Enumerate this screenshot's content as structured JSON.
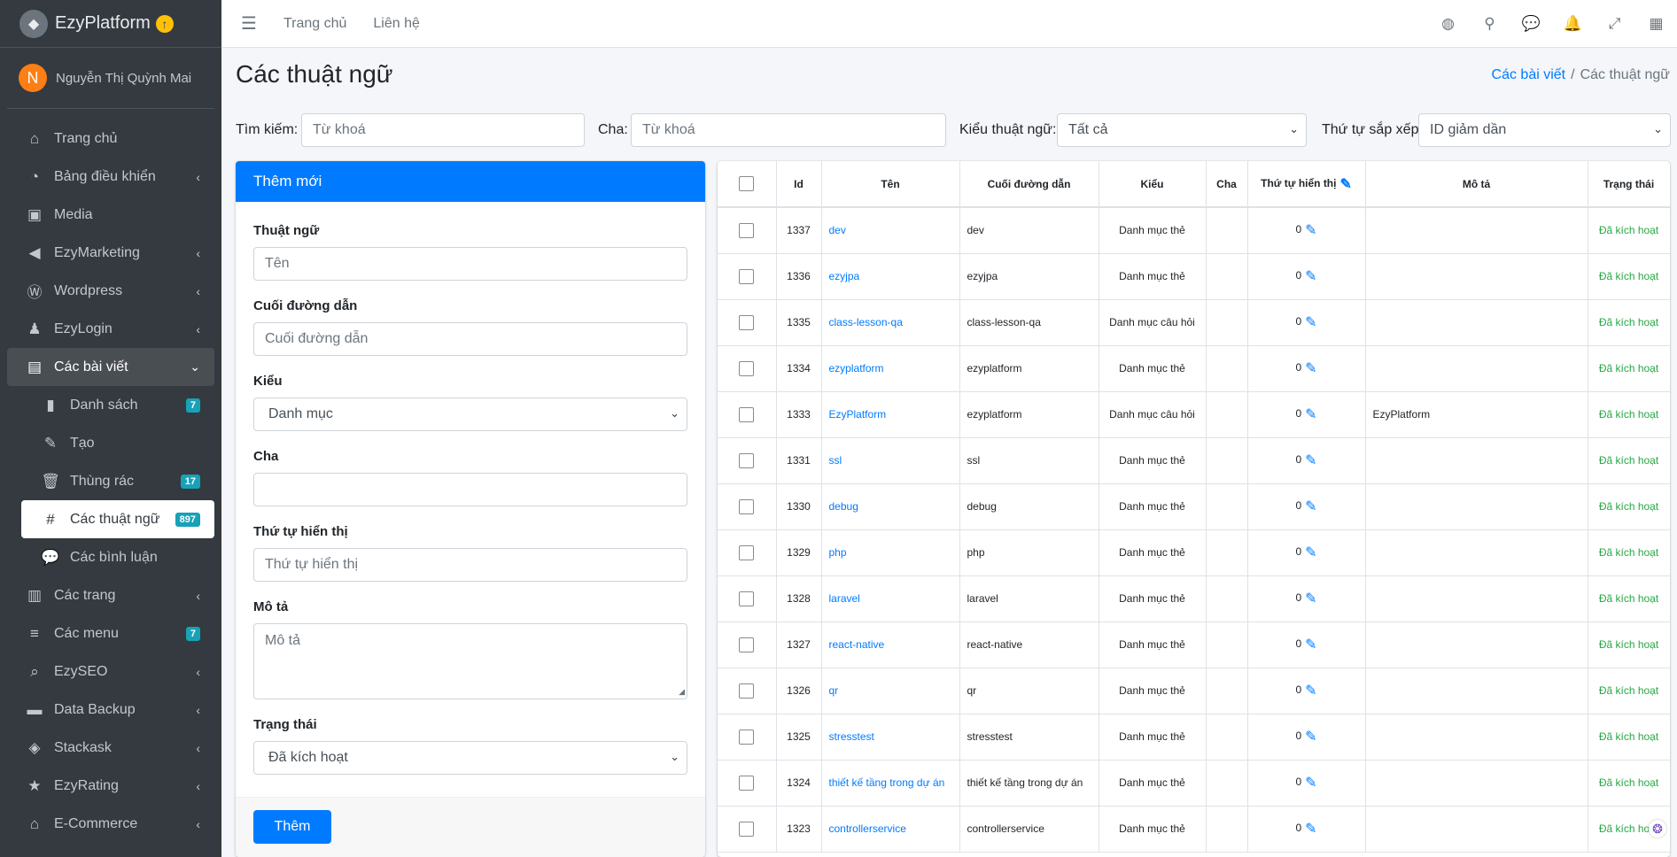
{
  "brand": {
    "name": "EzyPlatform",
    "logo_icon": "cube-icon",
    "upgrade_icon": "arrow-up-circle-icon"
  },
  "user": {
    "initial": "N",
    "name": "Nguyễn Thị Quỳnh Mai"
  },
  "sidebar": {
    "items": [
      {
        "label": "Trang chủ",
        "icon": "home-icon",
        "glyph": "⌂"
      },
      {
        "label": "Bảng điều khiển",
        "icon": "dashboard-icon",
        "glyph": "◔",
        "arrow": "‹"
      },
      {
        "label": "Media",
        "icon": "image-icon",
        "glyph": "▣"
      },
      {
        "label": "EzyMarketing",
        "icon": "bullhorn-icon",
        "glyph": "◀",
        "arrow": "‹"
      },
      {
        "label": "Wordpress",
        "icon": "wordpress-icon",
        "glyph": "Ⓦ",
        "arrow": "‹"
      },
      {
        "label": "EzyLogin",
        "icon": "user-lock-icon",
        "glyph": "♟",
        "arrow": "‹"
      },
      {
        "label": "Các bài viết",
        "icon": "newspaper-icon",
        "glyph": "▤",
        "arrow": "⌄"
      },
      {
        "label": "Danh sách",
        "icon": "book-icon",
        "glyph": "▮",
        "badge": "7"
      },
      {
        "label": "Tạo",
        "icon": "edit-icon",
        "glyph": "✎"
      },
      {
        "label": "Thùng rác",
        "icon": "trash-icon",
        "glyph": "🗑",
        "badge": "17"
      },
      {
        "label": "Các thuật ngữ",
        "icon": "hashtag-icon",
        "glyph": "#",
        "badge": "897"
      },
      {
        "label": "Các bình luận",
        "icon": "comments-icon",
        "glyph": "💬"
      },
      {
        "label": "Các trang",
        "icon": "columns-icon",
        "glyph": "▥",
        "arrow": "‹"
      },
      {
        "label": "Các menu",
        "icon": "bars-icon",
        "glyph": "≡",
        "badge": "7"
      },
      {
        "label": "EzySEO",
        "icon": "search-plus-icon",
        "glyph": "⌕",
        "arrow": "‹"
      },
      {
        "label": "Data Backup",
        "icon": "folder-icon",
        "glyph": "▬",
        "arrow": "‹"
      },
      {
        "label": "Stackask",
        "icon": "layer-group-icon",
        "glyph": "◈",
        "arrow": "‹"
      },
      {
        "label": "EzyRating",
        "icon": "star-icon",
        "glyph": "★",
        "arrow": "‹"
      },
      {
        "label": "E-Commerce",
        "icon": "store-icon",
        "glyph": "⌂",
        "arrow": "‹"
      }
    ]
  },
  "topnav": {
    "links": [
      "Trang chủ",
      "Liên hệ"
    ],
    "icons": [
      {
        "name": "globe-icon",
        "glyph": "◍"
      },
      {
        "name": "search-icon",
        "glyph": "⚲"
      },
      {
        "name": "comments-icon",
        "glyph": "💬"
      },
      {
        "name": "bell-icon",
        "glyph": "🔔"
      },
      {
        "name": "expand-icon",
        "glyph": "⤢"
      },
      {
        "name": "grid-icon",
        "glyph": "▦"
      }
    ]
  },
  "page": {
    "title": "Các thuật ngữ",
    "breadcrumb": {
      "parent": "Các bài viết",
      "current": "Các thuật ngữ"
    }
  },
  "filters": {
    "search_label": "Tìm kiếm:",
    "search_placeholder": "Từ khoá",
    "parent_label": "Cha:",
    "parent_placeholder": "Từ khoá",
    "type_label": "Kiểu thuật ngữ:",
    "type_value": "Tất cả",
    "sort_label": "Thứ tự sắp xếp:",
    "sort_value": "ID giảm dần"
  },
  "form": {
    "header": "Thêm mới",
    "term_label": "Thuật ngữ",
    "term_placeholder": "Tên",
    "slug_label": "Cuối đường dẫn",
    "slug_placeholder": "Cuối đường dẫn",
    "type_label": "Kiểu",
    "type_value": "Danh mục",
    "parent_label": "Cha",
    "parent_value": "",
    "order_label": "Thứ tự hiển thị",
    "order_placeholder": "Thứ tự hiển thị",
    "desc_label": "Mô tả",
    "desc_placeholder": "Mô tả",
    "status_label": "Trạng thái",
    "status_value": "Đã kích hoạt",
    "submit": "Thêm"
  },
  "table": {
    "headers": {
      "id": "Id",
      "name": "Tên",
      "slug": "Cuối đường dẫn",
      "type": "Kiểu",
      "parent": "Cha",
      "order": "Thứ tự hiển thị",
      "desc": "Mô tả",
      "status": "Trạng thái"
    },
    "rows": [
      {
        "id": "1337",
        "name": "dev",
        "slug": "dev",
        "type": "Danh mục thẻ",
        "parent": "",
        "order": "0",
        "desc": "",
        "status": "Đã kích hoạt"
      },
      {
        "id": "1336",
        "name": "ezyjpa",
        "slug": "ezyjpa",
        "type": "Danh mục thẻ",
        "parent": "",
        "order": "0",
        "desc": "",
        "status": "Đã kích hoạt"
      },
      {
        "id": "1335",
        "name": "class-lesson-qa",
        "slug": "class-lesson-qa",
        "type": "Danh mục câu hỏi",
        "parent": "",
        "order": "0",
        "desc": "",
        "status": "Đã kích hoạt"
      },
      {
        "id": "1334",
        "name": "ezyplatform",
        "slug": "ezyplatform",
        "type": "Danh mục thẻ",
        "parent": "",
        "order": "0",
        "desc": "",
        "status": "Đã kích hoạt"
      },
      {
        "id": "1333",
        "name": "EzyPlatform",
        "slug": "ezyplatform",
        "type": "Danh mục câu hỏi",
        "parent": "",
        "order": "0",
        "desc": "EzyPlatform",
        "status": "Đã kích hoạt"
      },
      {
        "id": "1331",
        "name": "ssl",
        "slug": "ssl",
        "type": "Danh mục thẻ",
        "parent": "",
        "order": "0",
        "desc": "",
        "status": "Đã kích hoạt"
      },
      {
        "id": "1330",
        "name": "debug",
        "slug": "debug",
        "type": "Danh mục thẻ",
        "parent": "",
        "order": "0",
        "desc": "",
        "status": "Đã kích hoạt"
      },
      {
        "id": "1329",
        "name": "php",
        "slug": "php",
        "type": "Danh mục thẻ",
        "parent": "",
        "order": "0",
        "desc": "",
        "status": "Đã kích hoạt"
      },
      {
        "id": "1328",
        "name": "laravel",
        "slug": "laravel",
        "type": "Danh mục thẻ",
        "parent": "",
        "order": "0",
        "desc": "",
        "status": "Đã kích hoạt"
      },
      {
        "id": "1327",
        "name": "react-native",
        "slug": "react-native",
        "type": "Danh mục thẻ",
        "parent": "",
        "order": "0",
        "desc": "",
        "status": "Đã kích hoạt"
      },
      {
        "id": "1326",
        "name": "qr",
        "slug": "qr",
        "type": "Danh mục thẻ",
        "parent": "",
        "order": "0",
        "desc": "",
        "status": "Đã kích hoạt"
      },
      {
        "id": "1325",
        "name": "stresstest",
        "slug": "stresstest",
        "type": "Danh mục thẻ",
        "parent": "",
        "order": "0",
        "desc": "",
        "status": "Đã kích hoạt"
      },
      {
        "id": "1324",
        "name": "thiết kế tầng trong dự án",
        "slug": "thiết kế tầng trong dự án",
        "type": "Danh mục thẻ",
        "parent": "",
        "order": "0",
        "desc": "",
        "status": "Đã kích hoạt"
      },
      {
        "id": "1323",
        "name": "controllerservice",
        "slug": "controllerservice",
        "type": "Danh mục thẻ",
        "parent": "",
        "order": "0",
        "desc": "",
        "status": "Đã kích hoạt"
      }
    ]
  },
  "colors": {
    "primary": "#007bff",
    "sidebar": "#343a40",
    "success": "#28a745",
    "badge": "#17a2b8"
  }
}
